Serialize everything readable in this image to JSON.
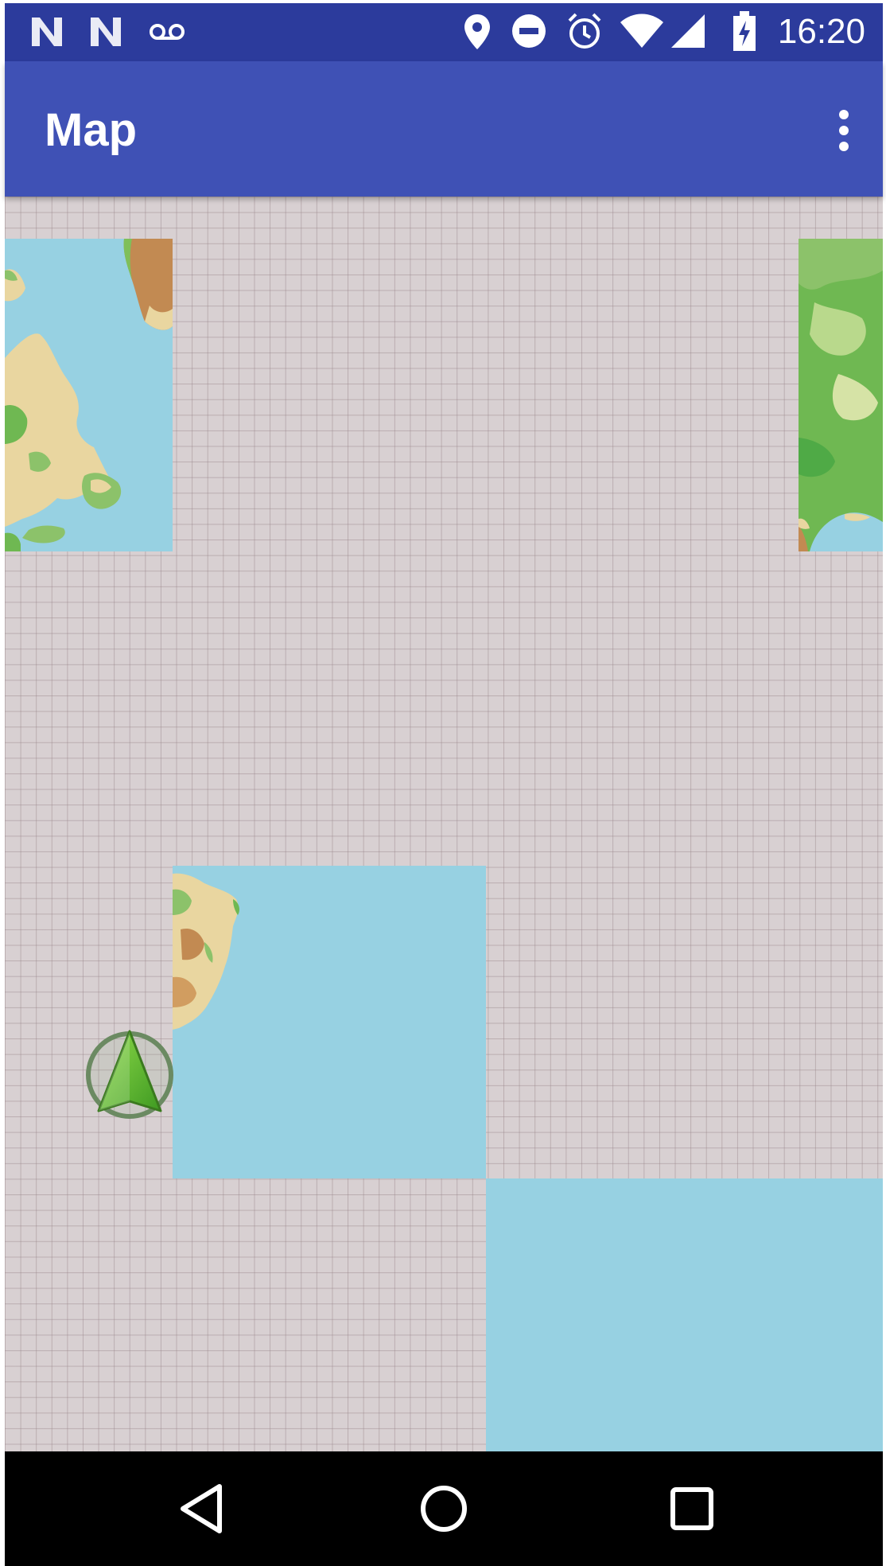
{
  "status_bar": {
    "time": "16:20",
    "icons": [
      "n-notification-icon",
      "n-notification-icon",
      "voicemail-icon",
      "location-icon",
      "do-not-disturb-icon",
      "alarm-icon",
      "wifi-icon",
      "cell-signal-icon",
      "battery-charging-icon"
    ]
  },
  "app_bar": {
    "title": "Map",
    "menu_icon": "more-vert-icon"
  },
  "map": {
    "locate_icon": "navigation-arrow-icon",
    "colors": {
      "water": "#97d1e2",
      "grid_background": "#d8d0d2",
      "land_green": "#5fb348",
      "land_tan": "#e9d6a0"
    }
  },
  "nav_bar": {
    "icons": [
      "back-icon",
      "home-icon",
      "recents-icon"
    ]
  }
}
